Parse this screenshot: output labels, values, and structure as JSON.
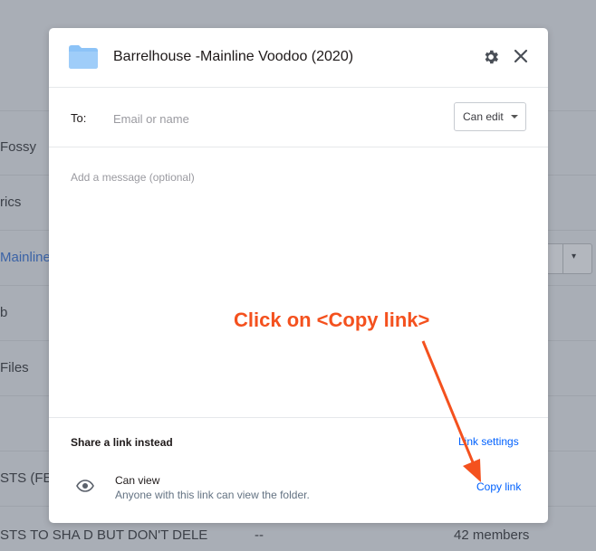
{
  "background": {
    "rows": [
      "Fossy",
      "rics",
      "Mainline",
      "b",
      "Files",
      "",
      "STS (FEE"
    ],
    "bottom_row_name": "STS TO SHA  D BUT DON'T DELE",
    "bottom_row_dash": "--",
    "bottom_row_members": "42 members"
  },
  "dialog": {
    "title": "Barrelhouse -Mainline Voodoo (2020)",
    "to_label": "To:",
    "to_placeholder": "Email or name",
    "permission": "Can edit",
    "message_placeholder": "Add a message (optional)",
    "share_section_title": "Share a link instead",
    "link_settings": "Link settings",
    "access_label": "Can view",
    "access_description": "Anyone with this link can view the folder.",
    "copy_link": "Copy link"
  },
  "annotation": {
    "text": "Click on <Copy link>",
    "color": "#f4511e"
  },
  "colors": {
    "link": "#0061fe",
    "folder": "#8cc3f7",
    "overlay": "#a9aeb6"
  },
  "icons": {
    "folder": "folder-icon",
    "settings": "gear-icon",
    "close": "close-icon",
    "visibility": "eye-icon"
  }
}
